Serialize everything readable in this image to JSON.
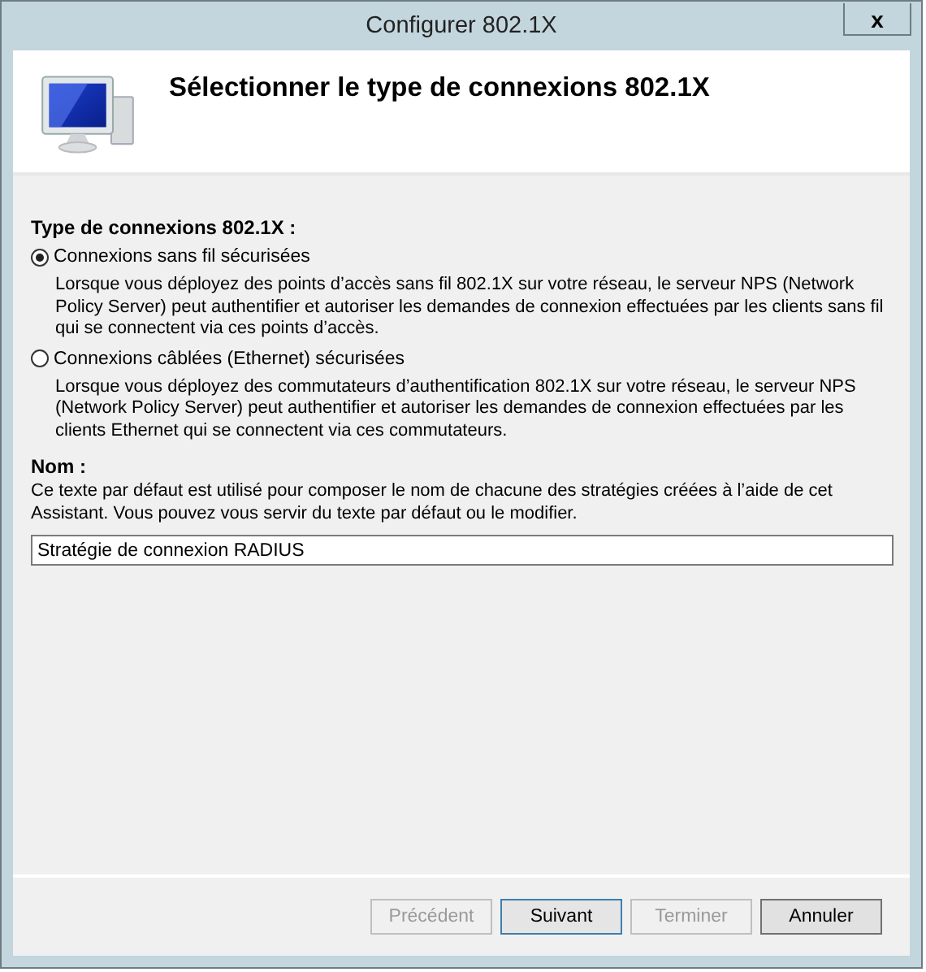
{
  "window": {
    "title": "Configurer 802.1X",
    "close": "x"
  },
  "header": {
    "title": "Sélectionner le type de connexions 802.1X"
  },
  "connection_type": {
    "label": "Type de connexions 802.1X :",
    "options": [
      {
        "label": "Connexions sans fil sécurisées",
        "selected": true,
        "description": "Lorsque vous déployez des points d’accès sans fil 802.1X sur votre réseau, le serveur NPS (Network Policy Server) peut authentifier et autoriser les demandes de connexion effectuées par les clients sans fil qui se connectent via ces points d’accès."
      },
      {
        "label": "Connexions câblées (Ethernet) sécurisées",
        "selected": false,
        "description": "Lorsque vous déployez des commutateurs d’authentification 802.1X sur votre réseau, le serveur NPS (Network Policy Server) peut authentifier et autoriser les demandes de connexion effectuées par les clients Ethernet qui se connectent via ces commutateurs."
      }
    ]
  },
  "name": {
    "label": "Nom :",
    "help": "Ce texte par défaut est utilisé pour composer le nom de chacune des stratégies créées à l’aide de cet Assistant. Vous pouvez vous servir du texte par défaut ou le modifier.",
    "value": "Stratégie de connexion RADIUS"
  },
  "buttons": [
    {
      "label": "Précédent",
      "disabled": true,
      "default": false
    },
    {
      "label": "Suivant",
      "disabled": false,
      "default": true
    },
    {
      "label": "Terminer",
      "disabled": true,
      "default": false
    },
    {
      "label": "Annuler",
      "disabled": false,
      "default": false
    }
  ]
}
